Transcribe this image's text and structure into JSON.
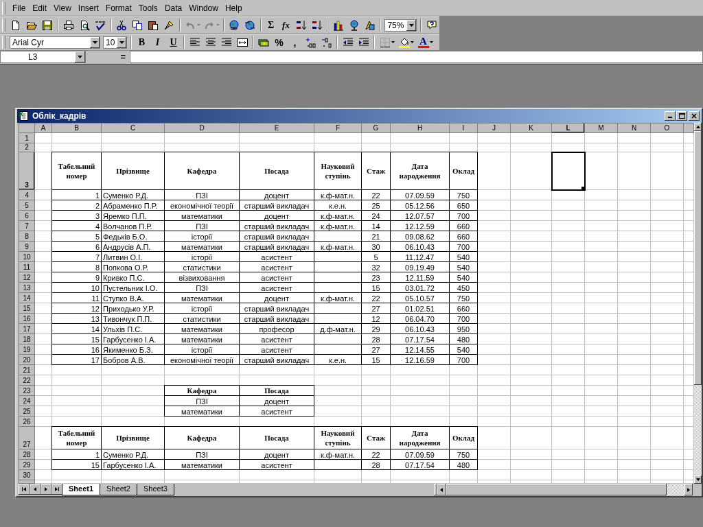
{
  "menu": [
    "File",
    "Edit",
    "View",
    "Insert",
    "Format",
    "Tools",
    "Data",
    "Window",
    "Help"
  ],
  "standard_toolbar": {
    "undo": {
      "disabled": true
    },
    "redo": {
      "disabled": true
    },
    "sum": "Σ",
    "function": "fx",
    "zoom": "75%"
  },
  "formatting_toolbar": {
    "font": "Arial Cyr",
    "font_size": "10",
    "bold": "B",
    "italic": "I",
    "underline": "U",
    "percent": "%",
    "comma": ",",
    "font_color": "A"
  },
  "formula_bar": {
    "name_box": "L3",
    "equals": "="
  },
  "workbook": {
    "title": "Облік_кадрів",
    "columns": [
      {
        "label": "A",
        "selected": false
      },
      {
        "label": "B",
        "selected": false
      },
      {
        "label": "C",
        "selected": false
      },
      {
        "label": "D",
        "selected": false
      },
      {
        "label": "E",
        "selected": false
      },
      {
        "label": "F",
        "selected": false
      },
      {
        "label": "G",
        "selected": false
      },
      {
        "label": "H",
        "selected": false
      },
      {
        "label": "I",
        "selected": false
      },
      {
        "label": "J",
        "selected": false
      },
      {
        "label": "K",
        "selected": false
      },
      {
        "label": "L",
        "selected": true
      },
      {
        "label": "M",
        "selected": false
      },
      {
        "label": "N",
        "selected": false
      },
      {
        "label": "O",
        "selected": false
      }
    ],
    "row_headers": [
      {
        "label": "1",
        "selected": false
      },
      {
        "label": "2",
        "selected": false
      },
      {
        "label": "3",
        "selected": true
      },
      {
        "label": "4",
        "selected": false
      },
      {
        "label": "5",
        "selected": false
      },
      {
        "label": "6",
        "selected": false
      },
      {
        "label": "7",
        "selected": false
      },
      {
        "label": "8",
        "selected": false
      },
      {
        "label": "9",
        "selected": false
      },
      {
        "label": "10",
        "selected": false
      },
      {
        "label": "11",
        "selected": false
      },
      {
        "label": "12",
        "selected": false
      },
      {
        "label": "13",
        "selected": false
      },
      {
        "label": "14",
        "selected": false
      },
      {
        "label": "15",
        "selected": false
      },
      {
        "label": "16",
        "selected": false
      },
      {
        "label": "17",
        "selected": false
      },
      {
        "label": "18",
        "selected": false
      },
      {
        "label": "19",
        "selected": false
      },
      {
        "label": "20",
        "selected": false
      },
      {
        "label": "21",
        "selected": false
      },
      {
        "label": "22",
        "selected": false
      },
      {
        "label": "23",
        "selected": false
      },
      {
        "label": "24",
        "selected": false
      },
      {
        "label": "25",
        "selected": false
      },
      {
        "label": "26",
        "selected": false
      },
      {
        "label": "27",
        "selected": false
      },
      {
        "label": "28",
        "selected": false
      },
      {
        "label": "29",
        "selected": false
      },
      {
        "label": "30",
        "selected": false
      }
    ],
    "staff_table": {
      "header": [
        "Табельний номер",
        "Прізвище",
        "Кафедра",
        "Посада",
        "Науковий ступінь",
        "Стаж",
        "Дата народження",
        "Оклад"
      ],
      "rows": [
        {
          "no": "1",
          "surname": "Суменко Р.Д.",
          "department": "ПЗІ",
          "position": "доцент",
          "degree": "к.ф-мат.н.",
          "experience": "22",
          "birth_date": "07.09.59",
          "salary": "750"
        },
        {
          "no": "2",
          "surname": "Абраменко П.Р.",
          "department": "економічної теорії",
          "position": "старший викладач",
          "degree": "к.е.н.",
          "experience": "25",
          "birth_date": "05.12.56",
          "salary": "650"
        },
        {
          "no": "3",
          "surname": "Яремко П.П.",
          "department": "математики",
          "position": "доцент",
          "degree": "к.ф-мат.н.",
          "experience": "24",
          "birth_date": "12.07.57",
          "salary": "700"
        },
        {
          "no": "4",
          "surname": "Волчанов П.Р.",
          "department": "ПЗІ",
          "position": "старший викладач",
          "degree": "к.ф-мат.н.",
          "experience": "14",
          "birth_date": "12.12.59",
          "salary": "660"
        },
        {
          "no": "5",
          "surname": "Федьків Б.О.",
          "department": "історії",
          "position": "старший викладач",
          "experience": "21",
          "birth_date": "09.08.62",
          "salary": "660"
        },
        {
          "no": "6",
          "surname": "Андрусів А.П.",
          "department": "математики",
          "position": "старший викладач",
          "degree": "к.ф-мат.н.",
          "experience": "30",
          "birth_date": "06.10.43",
          "salary": "700"
        },
        {
          "no": "7",
          "surname": "Литвин О.І.",
          "department": "історії",
          "position": "асистент",
          "experience": "5",
          "birth_date": "11.12.47",
          "salary": "540"
        },
        {
          "no": "8",
          "surname": "Попкова О.Р.",
          "department": "статистики",
          "position": "асистент",
          "experience": "32",
          "birth_date": "09.19.49",
          "salary": "540"
        },
        {
          "no": "9",
          "surname": "Кривко П.С.",
          "department": "візвиховання",
          "position": "асистент",
          "experience": "23",
          "birth_date": "12.11.59",
          "salary": "540"
        },
        {
          "no": "10",
          "surname": "Пустельник І.О.",
          "department": "ПЗІ",
          "position": "асистент",
          "experience": "15",
          "birth_date": "03.01.72",
          "salary": "450"
        },
        {
          "no": "11",
          "surname": "Ступко В.А.",
          "department": "математики",
          "position": "доцент",
          "degree": "к.ф-мат.н.",
          "experience": "22",
          "birth_date": "05.10.57",
          "salary": "750"
        },
        {
          "no": "12",
          "surname": "Приходько У.Р.",
          "department": "історії",
          "position": "старший викладач",
          "experience": "27",
          "birth_date": "01.02.51",
          "salary": "660"
        },
        {
          "no": "13",
          "surname": "Тивончук П.П.",
          "department": "статистики",
          "position": "старший викладач",
          "experience": "12",
          "birth_date": "06.04.70",
          "salary": "700"
        },
        {
          "no": "14",
          "surname": "Ульхів П.С.",
          "department": "математики",
          "position": "професор",
          "degree": "д.ф-мат.н.",
          "experience": "29",
          "birth_date": "06.10.43",
          "salary": "950"
        },
        {
          "no": "15",
          "surname": "Гарбусенко І.А.",
          "department": "математики",
          "position": "асистент",
          "experience": "28",
          "birth_date": "07.17.54",
          "salary": "480"
        },
        {
          "no": "16",
          "surname": "Якименко Б.З.",
          "department": "історії",
          "position": "асистент",
          "experience": "27",
          "birth_date": "12.14.55",
          "salary": "540"
        },
        {
          "no": "17",
          "surname": "Бобров А.В.",
          "department": "економічної теорії",
          "position": "старший викладач",
          "degree": "к.е.н.",
          "experience": "15",
          "birth_date": "12.16.59",
          "salary": "700"
        }
      ]
    },
    "criteria_table": {
      "header": [
        "Кафедра",
        "Посада"
      ],
      "rows": [
        [
          "ПЗІ",
          "доцент"
        ],
        [
          "математики",
          "асистент"
        ]
      ]
    },
    "result_table": {
      "header": [
        "Табельний номер",
        "Прізвище",
        "Кафедра",
        "Посада",
        "Науковий ступінь",
        "Стаж",
        "Дата народження",
        "Оклад"
      ],
      "rows": [
        {
          "no": "1",
          "surname": "Суменко Р.Д.",
          "department": "ПЗІ",
          "position": "доцент",
          "degree": "к.ф-мат.н.",
          "experience": "22",
          "birth_date": "07.09.59",
          "salary": "750"
        },
        {
          "no": "15",
          "surname": "Гарбусенко І.А.",
          "department": "математики",
          "position": "асистент",
          "experience": "28",
          "birth_date": "07.17.54",
          "salary": "480"
        }
      ]
    },
    "sheet_tabs": [
      {
        "label": "Sheet1",
        "selected": true
      },
      {
        "label": "Sheet2",
        "selected": false
      },
      {
        "label": "Sheet3",
        "selected": false
      }
    ]
  }
}
